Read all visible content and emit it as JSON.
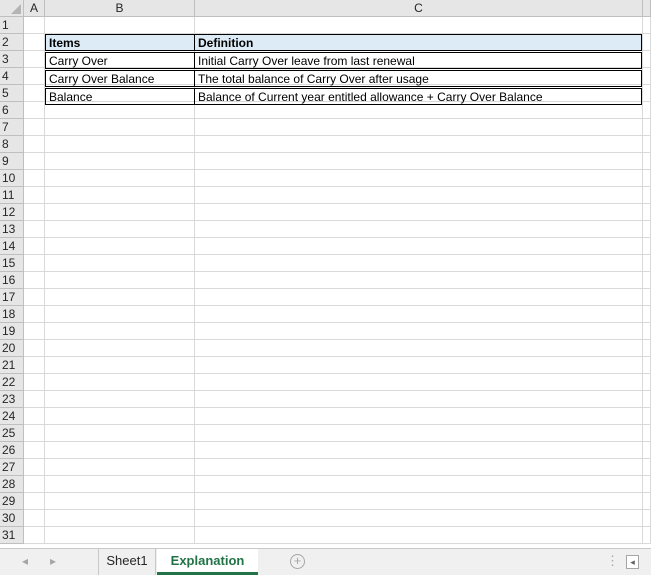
{
  "sheet": {
    "columns": [
      "A",
      "B",
      "C"
    ],
    "rows": [
      "1",
      "2",
      "3",
      "4",
      "5",
      "6",
      "7",
      "8",
      "9",
      "10",
      "11",
      "12",
      "13",
      "14",
      "15",
      "16",
      "17",
      "18",
      "19",
      "20",
      "21",
      "22",
      "23",
      "24",
      "25",
      "26",
      "27",
      "28",
      "29",
      "30",
      "31"
    ],
    "table": {
      "header": {
        "items": "Items",
        "definition": "Definition"
      },
      "rows": [
        {
          "item": "Carry Over",
          "definition": "Initial Carry Over leave from last renewal"
        },
        {
          "item": "Carry Over Balance",
          "definition": "The total balance of Carry Over after usage"
        },
        {
          "item": "Balance",
          "definition": "Balance of Current year entitled allowance + Carry Over Balance"
        }
      ]
    },
    "header_fill": "#ddebf7"
  },
  "tabs": {
    "items": [
      "Sheet1",
      "Explanation"
    ],
    "active": "Explanation",
    "accent": "#217346",
    "nav_prev": "◂",
    "nav_next": "▸",
    "add": "+",
    "more": "⋮",
    "scroll_left": "◂"
  }
}
